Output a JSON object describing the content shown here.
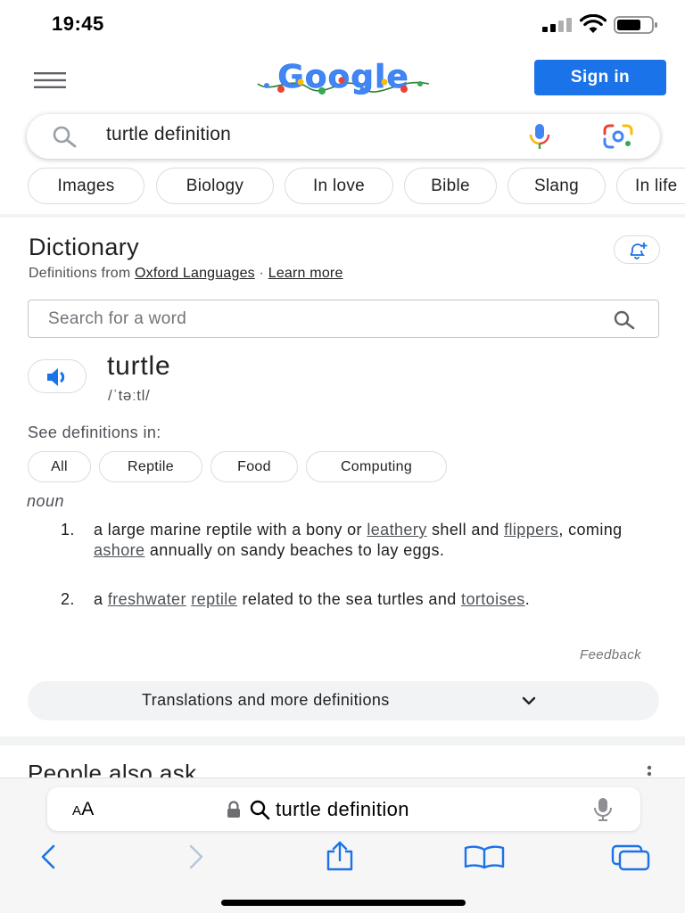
{
  "status_bar": {
    "time": "19:45"
  },
  "header": {
    "logo_text": "Google",
    "sign_in_label": "Sign in"
  },
  "search": {
    "query": "turtle definition"
  },
  "chips": [
    "Images",
    "Biology",
    "In love",
    "Bible",
    "Slang",
    "In life"
  ],
  "dictionary": {
    "title": "Dictionary",
    "source_prefix": "Definitions from",
    "source_link": "Oxford Languages",
    "separator": "·",
    "learn_more": "Learn more",
    "word_search_placeholder": "Search for a word",
    "headword": "turtle",
    "phonetic": "/ˈtəːtl/",
    "see_definitions_label": "See definitions in:",
    "categories": [
      "All",
      "Reptile",
      "Food",
      "Computing"
    ],
    "part_of_speech": "noun",
    "definitions": [
      {
        "number": "1.",
        "segments": [
          {
            "t": "a large marine reptile with a bony or "
          },
          {
            "t": "leathery",
            "link": true
          },
          {
            "t": " shell and "
          },
          {
            "t": "flippers",
            "link": true
          },
          {
            "t": ", coming "
          },
          {
            "t": "ashore",
            "link": true
          },
          {
            "t": " annually on sandy beaches to lay eggs."
          }
        ]
      },
      {
        "number": "2.",
        "segments": [
          {
            "t": "a "
          },
          {
            "t": "freshwater",
            "link": true
          },
          {
            "t": " "
          },
          {
            "t": "reptile",
            "link": true
          },
          {
            "t": " related to the sea turtles and "
          },
          {
            "t": "tortoises",
            "link": true
          },
          {
            "t": "."
          }
        ]
      }
    ],
    "feedback": "Feedback",
    "more_button": "Translations and more definitions"
  },
  "people_also_ask": "People also ask",
  "safari": {
    "aa_label_small": "A",
    "aa_label_large": "A",
    "url_text": "turtle definition"
  },
  "colors": {
    "brand_blue": "#1a73e8",
    "speaker_blue": "#1a73e8",
    "ios_blue": "#1a73e8"
  },
  "icons": {
    "menu": "hamburger-menu-icon",
    "search": "search-icon",
    "mic": "microphone-icon",
    "lens": "google-lens-icon",
    "alert": "add-alert-icon",
    "speaker": "speaker-icon",
    "chevron": "chevron-down-icon",
    "kebab": "more-vert-icon",
    "back": "back-arrow-icon",
    "forward": "forward-arrow-icon",
    "share": "share-icon",
    "bookmarks": "bookmarks-icon",
    "tabs": "tabs-icon"
  }
}
